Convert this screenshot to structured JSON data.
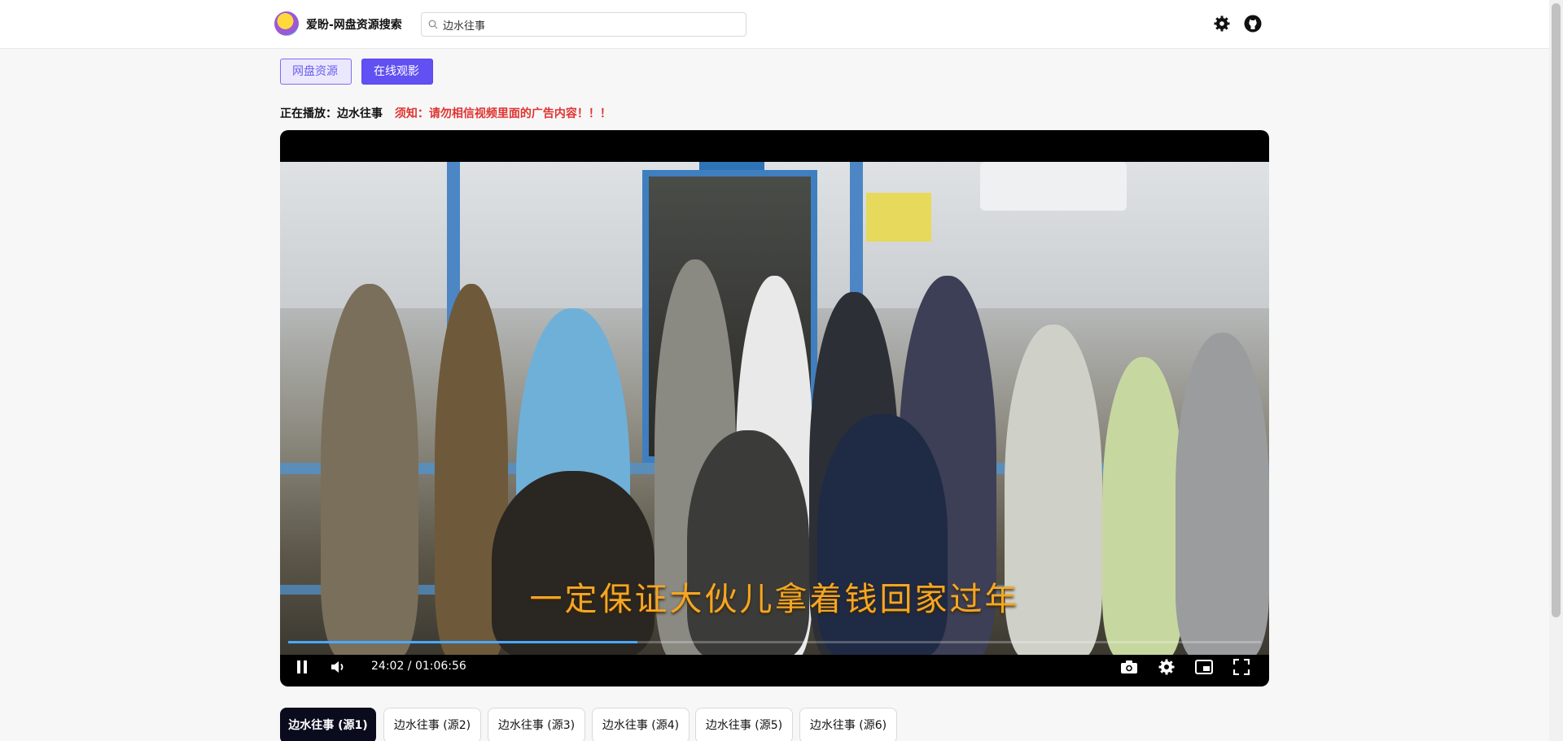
{
  "header": {
    "app_title": "爱盼-网盘资源搜索",
    "search_value": "边水往事",
    "icons": [
      "logo",
      "search-icon",
      "settings-icon",
      "github-icon"
    ]
  },
  "tabs": [
    {
      "label": "网盘资源",
      "active": false
    },
    {
      "label": "在线观影",
      "active": true
    }
  ],
  "now_playing": {
    "label": "正在播放：边水往事",
    "notice": "须知：请勿相信视频里面的广告内容！！！"
  },
  "player": {
    "subtitle": "一定保证大伙儿拿着钱回家过年",
    "time": "24:02 / 01:06:56",
    "progress_fraction": 0.359,
    "controls": [
      "pause-icon",
      "volume-icon",
      "screenshot-icon",
      "settings-icon",
      "picture-in-picture-icon",
      "fullscreen-icon"
    ]
  },
  "episodes": [
    {
      "label": "边水往事 (源1)",
      "active": true
    },
    {
      "label": "边水往事 (源2)",
      "active": false
    },
    {
      "label": "边水往事 (源3)",
      "active": false
    },
    {
      "label": "边水往事 (源4)",
      "active": false
    },
    {
      "label": "边水往事 (源5)",
      "active": false
    },
    {
      "label": "边水往事 (源6)",
      "active": false
    }
  ],
  "colors": {
    "accent": "#6150f2",
    "notice": "#e0332f",
    "subtitle": "#f5a623",
    "progress": "#4aa8ff"
  }
}
